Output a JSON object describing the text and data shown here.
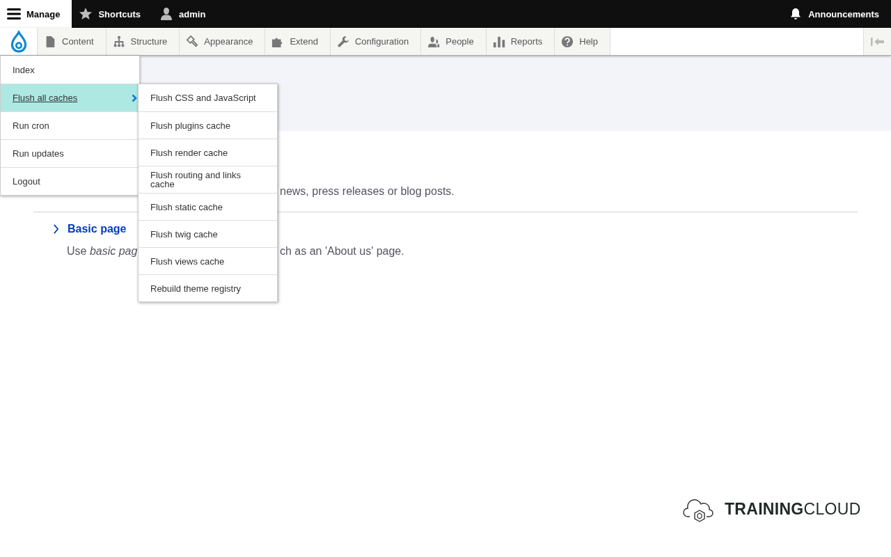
{
  "top_bar": {
    "items": [
      {
        "label": "Manage",
        "kind": "menu",
        "selected": true
      },
      {
        "label": "Shortcuts",
        "kind": "star",
        "selected": false
      },
      {
        "label": "admin",
        "kind": "person",
        "selected": false
      }
    ],
    "right_item": {
      "label": "Announcements"
    }
  },
  "tray": {
    "items": [
      {
        "label": "Content",
        "kind": "page"
      },
      {
        "label": "Structure",
        "kind": "tree"
      },
      {
        "label": "Appearance",
        "kind": "brush"
      },
      {
        "label": "Extend",
        "kind": "puzzle"
      },
      {
        "label": "Configuration",
        "kind": "wrench"
      },
      {
        "label": "People",
        "kind": "people"
      },
      {
        "label": "Reports",
        "kind": "bars"
      },
      {
        "label": "Help",
        "kind": "help"
      }
    ]
  },
  "manage_menu": {
    "items": [
      {
        "label": "Index",
        "selected": false,
        "has_submenu": false
      },
      {
        "label": "Flush all caches",
        "selected": true,
        "has_submenu": true
      },
      {
        "label": "Run cron",
        "selected": false,
        "has_submenu": false
      },
      {
        "label": "Run updates",
        "selected": false,
        "has_submenu": false
      },
      {
        "label": "Logout",
        "selected": false,
        "has_submenu": false
      }
    ]
  },
  "submenu": {
    "items": [
      "Flush CSS and JavaScript",
      "Flush plugins cache",
      "Flush render cache",
      "Flush routing and links cache",
      "Flush static cache",
      "Flush twig cache",
      "Flush views cache",
      "Rebuild theme registry"
    ]
  },
  "content": {
    "first_description_visible": "news, press releases or blog posts.",
    "entry": {
      "title": "Basic page",
      "description_start": "Use *basic pag*",
      "description_end": "ch as an 'About us' page."
    }
  },
  "footer": {
    "logo_bold": "TRAINING",
    "logo_light": "CLOUD"
  }
}
